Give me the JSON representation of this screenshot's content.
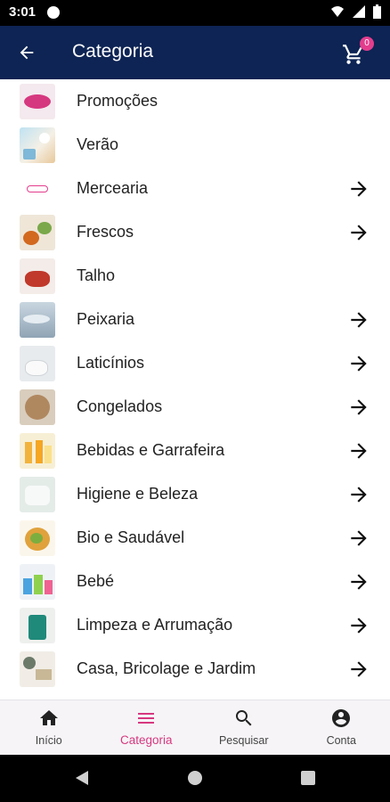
{
  "status_bar": {
    "time": "3:01"
  },
  "app_bar": {
    "title": "Categoria",
    "cart_count": "0",
    "back_icon": "arrow-left-icon",
    "cart_icon": "shopping-cart-icon"
  },
  "categories": [
    {
      "label": "Promoções",
      "has_arrow": false
    },
    {
      "label": "Verão",
      "has_arrow": false
    },
    {
      "label": "Mercearia",
      "has_arrow": true
    },
    {
      "label": "Frescos",
      "has_arrow": true
    },
    {
      "label": "Talho",
      "has_arrow": false
    },
    {
      "label": "Peixaria",
      "has_arrow": true
    },
    {
      "label": "Laticínios",
      "has_arrow": true
    },
    {
      "label": "Congelados",
      "has_arrow": true
    },
    {
      "label": "Bebidas e Garrafeira",
      "has_arrow": true
    },
    {
      "label": "Higiene e Beleza",
      "has_arrow": true
    },
    {
      "label": "Bio e Saudável",
      "has_arrow": true
    },
    {
      "label": "Bebé",
      "has_arrow": true
    },
    {
      "label": "Limpeza e Arrumação",
      "has_arrow": true
    },
    {
      "label": "Casa, Bricolage e Jardim",
      "has_arrow": true
    }
  ],
  "bottom_nav": {
    "items": [
      {
        "label": "Início",
        "icon": "home-icon"
      },
      {
        "label": "Categoria",
        "icon": "menu-icon",
        "active": true
      },
      {
        "label": "Pesquisar",
        "icon": "search-icon"
      },
      {
        "label": "Conta",
        "icon": "account-icon"
      }
    ]
  },
  "colors": {
    "app_bar": "#0d2454",
    "accent": "#d6387f",
    "badge": "#e33d8d"
  }
}
